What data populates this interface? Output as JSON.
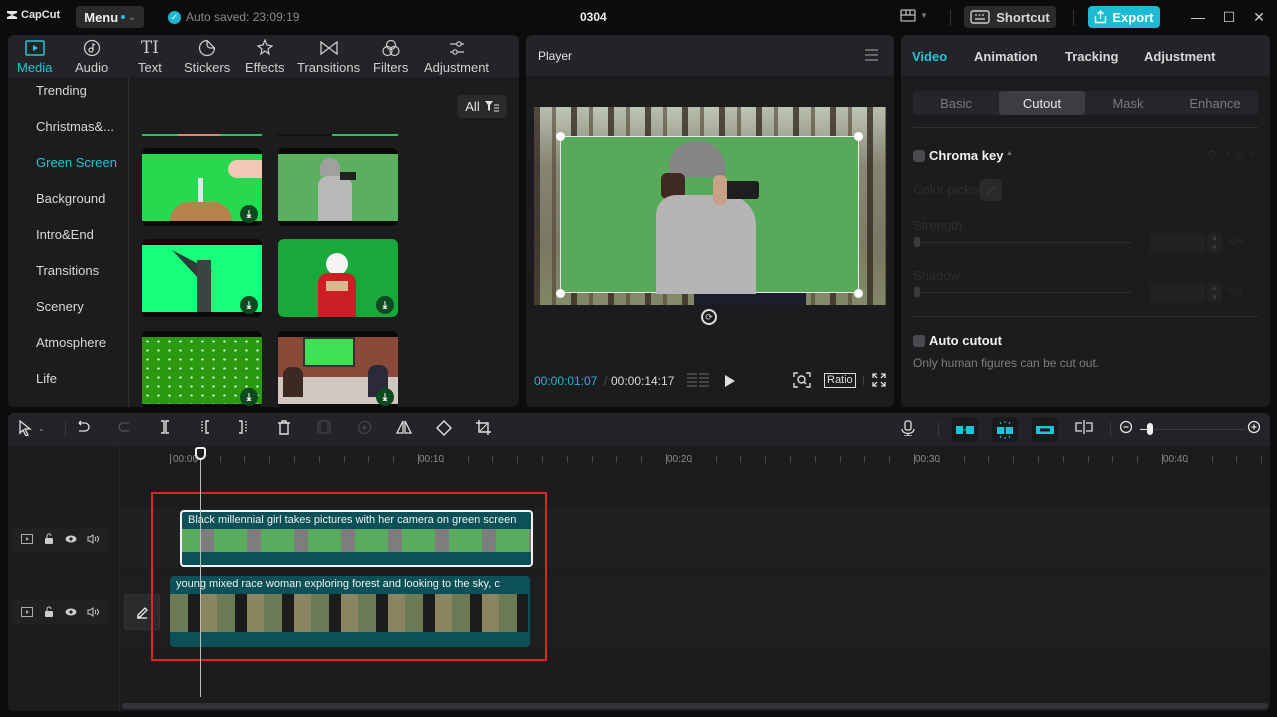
{
  "titlebar": {
    "app_name": "CapCut",
    "menu_label": "Menu",
    "autosave_text": "Auto saved: 23:09:19",
    "project_title": "0304",
    "shortcut_label": "Shortcut",
    "export_label": "Export",
    "accent_color": "#1cbad3"
  },
  "media_panel": {
    "tabs": [
      {
        "label": "Media",
        "icon": "media-icon",
        "active": true
      },
      {
        "label": "Audio",
        "icon": "audio-icon"
      },
      {
        "label": "Text",
        "icon": "text-icon"
      },
      {
        "label": "Stickers",
        "icon": "sticker-icon"
      },
      {
        "label": "Effects",
        "icon": "effects-icon"
      },
      {
        "label": "Transitions",
        "icon": "transitions-icon"
      },
      {
        "label": "Filters",
        "icon": "filters-icon"
      },
      {
        "label": "Adjustment",
        "icon": "adjustment-icon"
      }
    ],
    "categories": [
      {
        "label": "Trending"
      },
      {
        "label": "Christmas&..."
      },
      {
        "label": "Green Screen",
        "active": true
      },
      {
        "label": "Background"
      },
      {
        "label": "Intro&End"
      },
      {
        "label": "Transitions"
      },
      {
        "label": "Scenery"
      },
      {
        "label": "Atmosphere"
      },
      {
        "label": "Life"
      }
    ],
    "filter_label": "All",
    "thumbnails": [
      {
        "subject": "birthday cake candle green screen",
        "downloadable": true
      },
      {
        "subject": "photographer green screen",
        "downloadable": false
      },
      {
        "subject": "angel statue green screen",
        "downloadable": true
      },
      {
        "subject": "santa claus green screen",
        "downloadable": true
      },
      {
        "subject": "snow particles green screen",
        "downloadable": true
      },
      {
        "subject": "office meeting green screen monitor",
        "downloadable": true
      }
    ]
  },
  "player": {
    "title": "Player",
    "current_time": "00:00:01:07",
    "separator": "/",
    "total_time": "00:00:14:17",
    "ratio_label": "Ratio"
  },
  "properties": {
    "tabs": [
      {
        "label": "Video",
        "active": true
      },
      {
        "label": "Animation"
      },
      {
        "label": "Tracking"
      },
      {
        "label": "Adjustment"
      }
    ],
    "subtabs": [
      {
        "label": "Basic"
      },
      {
        "label": "Cutout",
        "active": true
      },
      {
        "label": "Mask"
      },
      {
        "label": "Enhance"
      }
    ],
    "chroma_key": {
      "title": "Chroma key",
      "checked": false,
      "color_picker_label": "Color picker",
      "strength_label": "Strength",
      "strength_value": 0,
      "shadow_label": "Shadow",
      "shadow_value": 0
    },
    "auto_cutout": {
      "title": "Auto cutout",
      "checked": false,
      "hint": "Only human figures can be cut out."
    }
  },
  "timeline": {
    "ruler_labels": [
      "00:00",
      "00:10",
      "00:20",
      "00:30",
      "00:40"
    ],
    "clips": [
      {
        "track": 1,
        "label": "Black millennial girl takes pictures with her camera on green screen",
        "selected": true
      },
      {
        "track": 2,
        "label": "young mixed race woman exploring forest and looking to the sky, c"
      }
    ],
    "zoom_level": 0.05
  }
}
